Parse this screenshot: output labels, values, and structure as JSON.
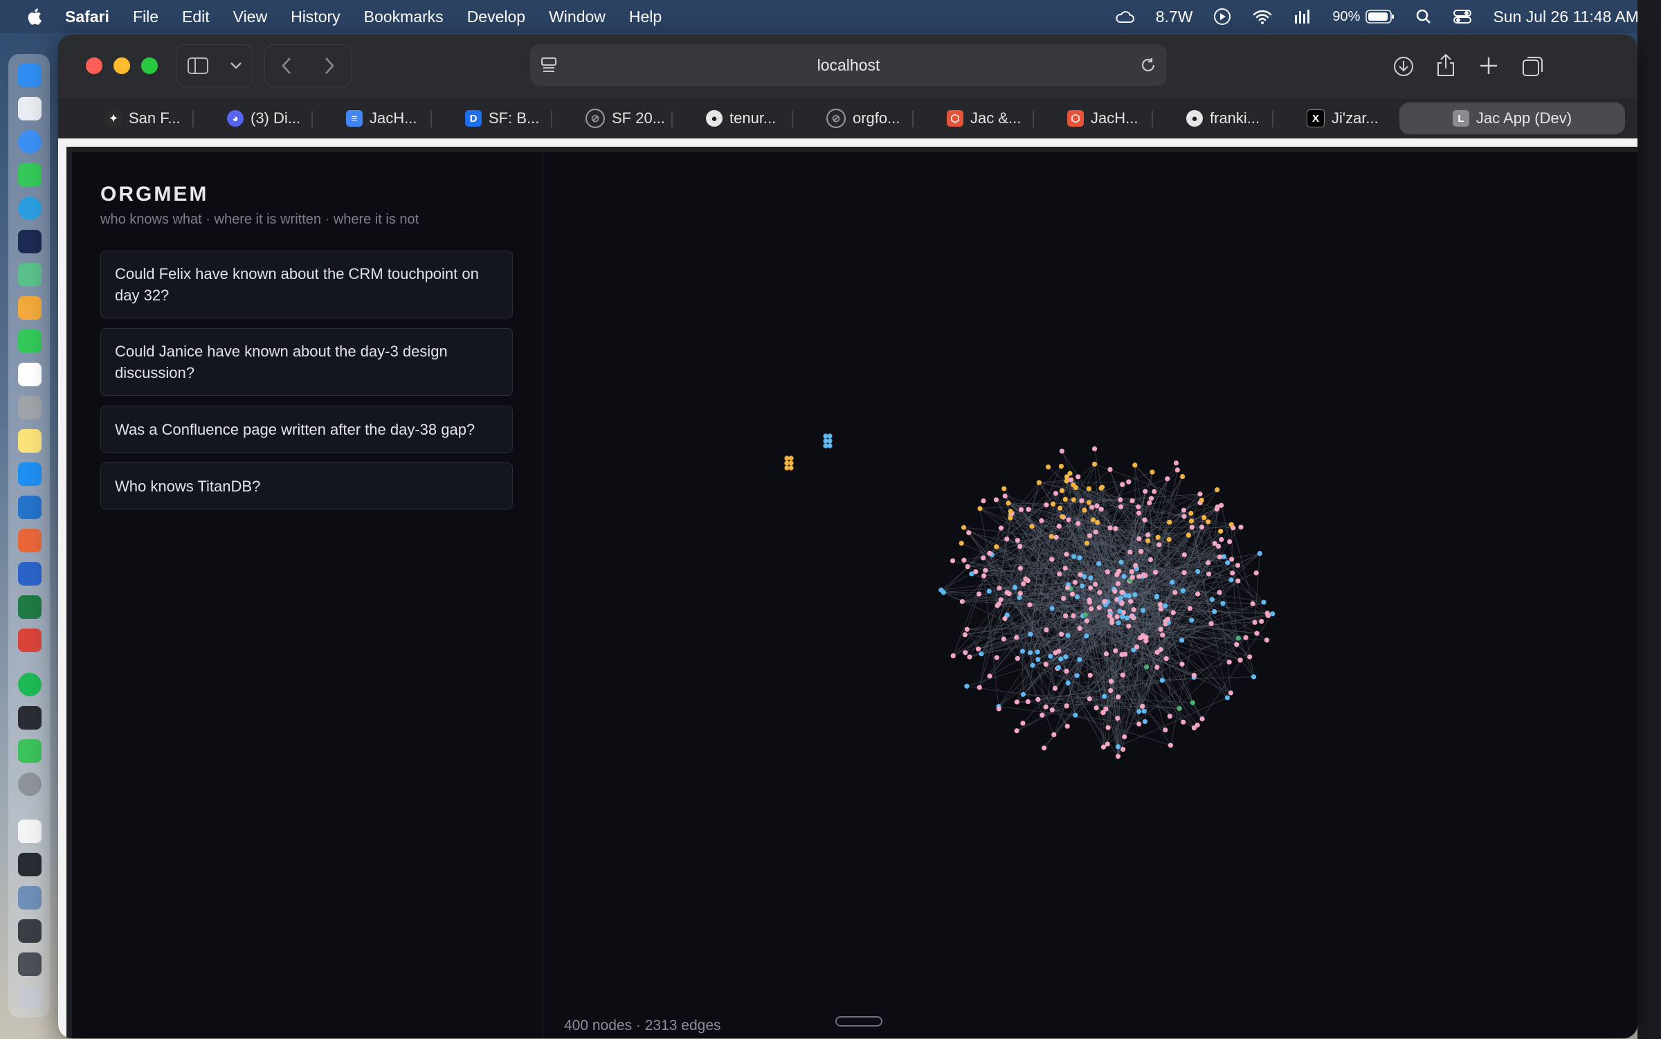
{
  "menubar": {
    "app_name": "Safari",
    "menus": [
      "File",
      "Edit",
      "View",
      "History",
      "Bookmarks",
      "Develop",
      "Window",
      "Help"
    ],
    "power": "8.7W",
    "battery": "90%",
    "datetime": "Sun Jul 26  11:48 AM"
  },
  "browser": {
    "url": "localhost",
    "tabs": [
      {
        "label": "San F...",
        "icon": "sparkle-icon",
        "color": "#2b2b2b"
      },
      {
        "label": "(3) Di...",
        "icon": "discord-icon",
        "color": "#5865f2"
      },
      {
        "label": "JacH...",
        "icon": "doc-icon",
        "color": "#4285f4"
      },
      {
        "label": "SF: B...",
        "icon": "d-icon",
        "color": "#1f6feb"
      },
      {
        "label": "SF 20...",
        "icon": "compass-icon",
        "color": "#6b6b70"
      },
      {
        "label": "tenur...",
        "icon": "github-icon",
        "color": "#222"
      },
      {
        "label": "orgfo...",
        "icon": "compass-icon",
        "color": "#6b6b70"
      },
      {
        "label": "Jac &...",
        "icon": "jac-icon",
        "color": "#e3543b"
      },
      {
        "label": "JacH...",
        "icon": "jac-icon",
        "color": "#e3543b"
      },
      {
        "label": "franki...",
        "icon": "github-icon",
        "color": "#222"
      },
      {
        "label": "Ji'zar...",
        "icon": "x-icon",
        "color": "#000"
      },
      {
        "label": "Jac App (Dev)",
        "icon": "l-icon",
        "color": "#8a8b90"
      }
    ]
  },
  "app": {
    "brand": "ORGMEM",
    "tagline": "who knows what · where it is written · where it is not",
    "questions": [
      "Could Felix have known about the CRM touchpoint on day 32?",
      "Could Janice have known about the day-3 design discussion?",
      "Was a Confluence page written after the day-38 gap?",
      "Who knows TitanDB?"
    ],
    "stats": "400 nodes · 2313 edges",
    "node_colors": {
      "person": "#f4a7c3",
      "doc": "#5fb8ef",
      "event": "#f2b441",
      "other": "#4caf72"
    }
  }
}
